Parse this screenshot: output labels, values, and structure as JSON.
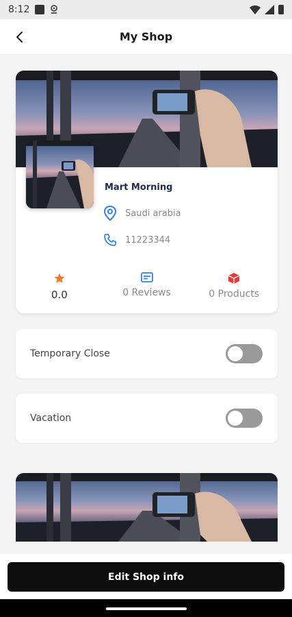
{
  "status_bar": {
    "time": "8:12"
  },
  "app_bar": {
    "title": "My Shop"
  },
  "shop": {
    "name": "Mart Morning",
    "location": "Saudi arabia",
    "phone": "11223344",
    "rating": "0.0",
    "reviews": "0 Reviews",
    "products": "0 Products"
  },
  "settings": {
    "temporary_close": {
      "label": "Temporary Close",
      "enabled": false
    },
    "vacation": {
      "label": "Vacation",
      "enabled": false
    }
  },
  "actions": {
    "edit_label": "Edit Shop info"
  },
  "colors": {
    "accent_blue": "#2f80ed",
    "star": "#f07a25",
    "products_icon": "#e53935",
    "button_bg": "#0c0c0c"
  }
}
